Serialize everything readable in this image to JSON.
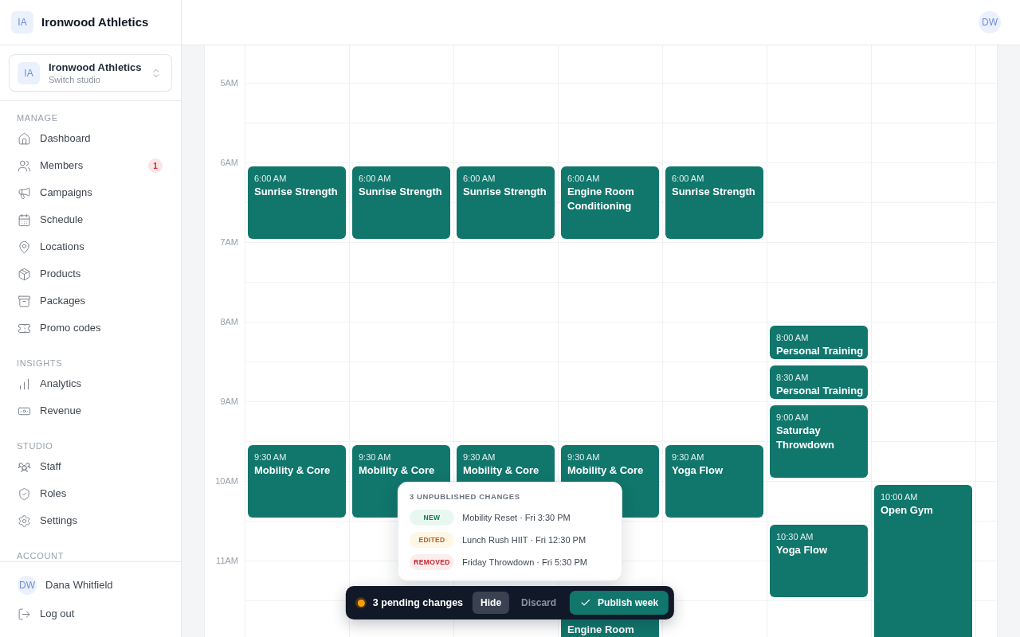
{
  "sidebar": {
    "brand": {
      "initials": "IA",
      "name": "Ironwood Athletics"
    },
    "studio_switcher": {
      "initials": "IA",
      "name": "Ironwood Athletics",
      "subtitle": "Switch studio"
    },
    "sections": [
      {
        "label": "MANAGE",
        "items": [
          {
            "label": "Dashboard"
          },
          {
            "label": "Members",
            "badge": "1"
          },
          {
            "label": "Campaigns"
          },
          {
            "label": "Schedule"
          },
          {
            "label": "Locations"
          },
          {
            "label": "Products"
          },
          {
            "label": "Packages"
          },
          {
            "label": "Promo codes"
          }
        ]
      },
      {
        "label": "INSIGHTS",
        "items": [
          {
            "label": "Analytics"
          },
          {
            "label": "Revenue"
          }
        ]
      },
      {
        "label": "STUDIO",
        "items": [
          {
            "label": "Staff"
          },
          {
            "label": "Roles"
          },
          {
            "label": "Settings"
          }
        ]
      },
      {
        "label": "ACCOUNT"
      }
    ],
    "account": {
      "initials": "DW",
      "name": "Dana Whitfield",
      "logout": "Log out"
    }
  },
  "top_bar": {
    "avatar_initials": "DW"
  },
  "calendar": {
    "hours": [
      "5AM",
      "6AM",
      "7AM",
      "8AM",
      "9AM",
      "10AM",
      "11AM"
    ],
    "days": [
      {
        "events": [
          {
            "time": "6:00 AM",
            "title": "Sunrise Strength",
            "kind": "hour"
          },
          {
            "time": "9:30 AM",
            "title": "Mobility & Core",
            "kind": "hour"
          }
        ]
      },
      {
        "events": [
          {
            "time": "6:00 AM",
            "title": "Sunrise Strength",
            "kind": "hour"
          },
          {
            "time": "9:30 AM",
            "title": "Mobility & Core",
            "kind": "hour"
          }
        ]
      },
      {
        "events": [
          {
            "time": "6:00 AM",
            "title": "Sunrise Strength",
            "kind": "hour"
          },
          {
            "time": "9:30 AM",
            "title": "Mobility & Core",
            "kind": "hour"
          }
        ]
      },
      {
        "events": [
          {
            "time": "6:00 AM",
            "title": "Engine Room Conditioning",
            "kind": "hour"
          },
          {
            "time": "9:30 AM",
            "title": "Mobility & Core",
            "kind": "hour"
          },
          {
            "title": "Engine Room",
            "kind": "open"
          }
        ]
      },
      {
        "events": [
          {
            "time": "6:00 AM",
            "title": "Sunrise Strength",
            "kind": "hour"
          },
          {
            "time": "9:30 AM",
            "title": "Yoga Flow",
            "kind": "hour"
          }
        ]
      },
      {
        "events": [
          {
            "time": "8:00 AM",
            "title": "Personal Training",
            "kind": "short"
          },
          {
            "time": "8:30 AM",
            "title": "Personal Training",
            "kind": "short"
          },
          {
            "time": "9:00 AM",
            "title": "Saturday Throwdown",
            "kind": "hour"
          },
          {
            "time": "10:30 AM",
            "title": "Yoga Flow",
            "kind": "hour"
          }
        ]
      },
      {
        "events": [
          {
            "time": "10:00 AM",
            "title": "Open Gym",
            "kind": "open"
          }
        ]
      }
    ]
  },
  "changes_popover": {
    "title": "3 UNPUBLISHED CHANGES",
    "items": [
      {
        "kind": "new",
        "badge": "NEW",
        "text": "Mobility Reset · Fri 3:30 PM"
      },
      {
        "kind": "edited",
        "badge": "EDITED",
        "text": "Lunch Rush HIIT · Fri 12:30 PM"
      },
      {
        "kind": "removed",
        "badge": "REMOVED",
        "text": "Friday Throwdown · Fri 5:30 PM"
      }
    ]
  },
  "pending_bar": {
    "status": "3 pending changes",
    "buttons": [
      {
        "kind": "hide",
        "label": "Hide"
      },
      {
        "kind": "discard",
        "label": "Discard"
      },
      {
        "kind": "publish",
        "label": "Publish week"
      }
    ]
  }
}
